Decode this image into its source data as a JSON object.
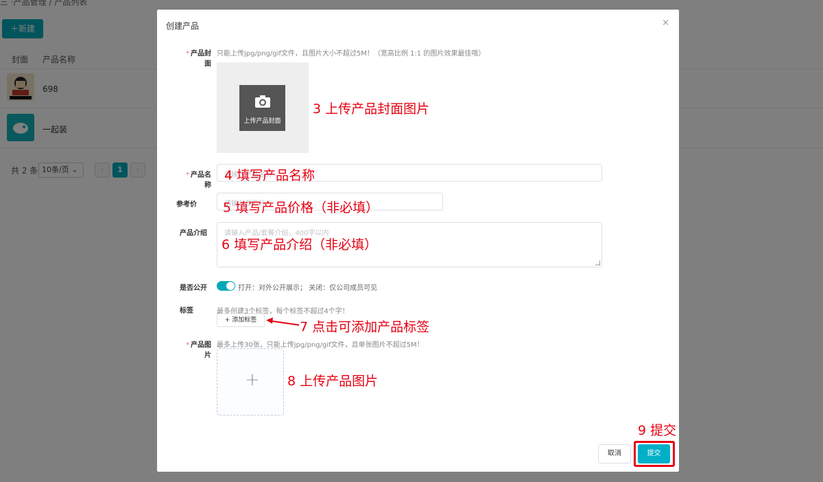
{
  "background": {
    "breadcrumb": "三  ·产品管理 / 产品列表",
    "new_button": "＋新建",
    "columns": [
      "封面",
      "产品名称"
    ],
    "rows": [
      {
        "name": "698"
      },
      {
        "name": "一起装"
      }
    ],
    "pagination": {
      "total": "共 2 条",
      "page_size": "10条/页",
      "prev": "‹",
      "current": "1",
      "next": "›"
    }
  },
  "modal": {
    "title": "创建产品",
    "close": "×",
    "cover": {
      "label": "产品封面",
      "hint": "只能上传jpg/png/gif文件，且图片大小不超过5M！（宽高比例 1:1 的图片效果最佳哦）",
      "upload_text": "上传产品封面"
    },
    "name": {
      "label": "产品名称",
      "placeholder": "请输入产品名称"
    },
    "price": {
      "label": "参考价",
      "placeholder": "请输入参考价"
    },
    "intro": {
      "label": "产品介绍",
      "placeholder": "请输入产品/套餐介绍，400字以内"
    },
    "public": {
      "label": "是否公开",
      "hint": "打开：对外公开展示； 关闭：仅公司成员可见",
      "enabled": true
    },
    "tags": {
      "label": "标签",
      "hint": "最多创建3个标签，每个标签不超过4个字！",
      "add_button": "+ 添加标签"
    },
    "images": {
      "label": "产品图片",
      "hint": "最多上传30张，只能上传jpg/png/gif文件，且单张图片不超过5M！",
      "plus": "+"
    },
    "cancel": "取消",
    "submit": "提交"
  },
  "annotations": {
    "a3": "3 上传产品封面图片",
    "a4": "4 填写产品名称",
    "a5": "5 填写产品价格（非必填）",
    "a6": "6 填写产品介绍（非必填）",
    "a7": "7  点击可添加产品标签",
    "a8": "8 上传产品图片",
    "a9": "9 提交"
  },
  "colors": {
    "accent": "#00a9b8",
    "annotation": "#e60012",
    "overlay": "rgba(0,0,0,0.5)"
  }
}
